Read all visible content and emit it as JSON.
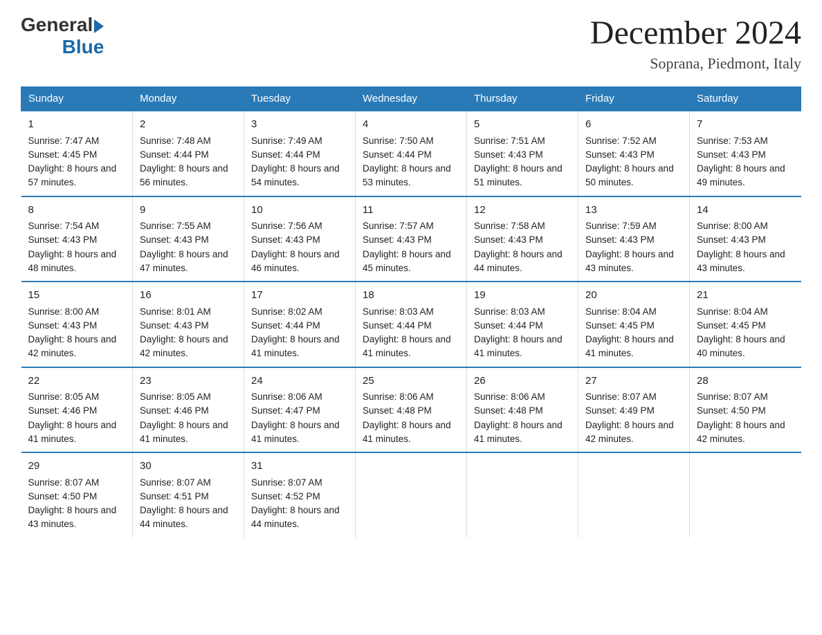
{
  "header": {
    "logo_general": "General",
    "logo_blue": "Blue",
    "main_title": "December 2024",
    "subtitle": "Soprana, Piedmont, Italy"
  },
  "days_of_week": [
    "Sunday",
    "Monday",
    "Tuesday",
    "Wednesday",
    "Thursday",
    "Friday",
    "Saturday"
  ],
  "weeks": [
    [
      {
        "day": "1",
        "sunrise": "7:47 AM",
        "sunset": "4:45 PM",
        "daylight": "8 hours and 57 minutes."
      },
      {
        "day": "2",
        "sunrise": "7:48 AM",
        "sunset": "4:44 PM",
        "daylight": "8 hours and 56 minutes."
      },
      {
        "day": "3",
        "sunrise": "7:49 AM",
        "sunset": "4:44 PM",
        "daylight": "8 hours and 54 minutes."
      },
      {
        "day": "4",
        "sunrise": "7:50 AM",
        "sunset": "4:44 PM",
        "daylight": "8 hours and 53 minutes."
      },
      {
        "day": "5",
        "sunrise": "7:51 AM",
        "sunset": "4:43 PM",
        "daylight": "8 hours and 51 minutes."
      },
      {
        "day": "6",
        "sunrise": "7:52 AM",
        "sunset": "4:43 PM",
        "daylight": "8 hours and 50 minutes."
      },
      {
        "day": "7",
        "sunrise": "7:53 AM",
        "sunset": "4:43 PM",
        "daylight": "8 hours and 49 minutes."
      }
    ],
    [
      {
        "day": "8",
        "sunrise": "7:54 AM",
        "sunset": "4:43 PM",
        "daylight": "8 hours and 48 minutes."
      },
      {
        "day": "9",
        "sunrise": "7:55 AM",
        "sunset": "4:43 PM",
        "daylight": "8 hours and 47 minutes."
      },
      {
        "day": "10",
        "sunrise": "7:56 AM",
        "sunset": "4:43 PM",
        "daylight": "8 hours and 46 minutes."
      },
      {
        "day": "11",
        "sunrise": "7:57 AM",
        "sunset": "4:43 PM",
        "daylight": "8 hours and 45 minutes."
      },
      {
        "day": "12",
        "sunrise": "7:58 AM",
        "sunset": "4:43 PM",
        "daylight": "8 hours and 44 minutes."
      },
      {
        "day": "13",
        "sunrise": "7:59 AM",
        "sunset": "4:43 PM",
        "daylight": "8 hours and 43 minutes."
      },
      {
        "day": "14",
        "sunrise": "8:00 AM",
        "sunset": "4:43 PM",
        "daylight": "8 hours and 43 minutes."
      }
    ],
    [
      {
        "day": "15",
        "sunrise": "8:00 AM",
        "sunset": "4:43 PM",
        "daylight": "8 hours and 42 minutes."
      },
      {
        "day": "16",
        "sunrise": "8:01 AM",
        "sunset": "4:43 PM",
        "daylight": "8 hours and 42 minutes."
      },
      {
        "day": "17",
        "sunrise": "8:02 AM",
        "sunset": "4:44 PM",
        "daylight": "8 hours and 41 minutes."
      },
      {
        "day": "18",
        "sunrise": "8:03 AM",
        "sunset": "4:44 PM",
        "daylight": "8 hours and 41 minutes."
      },
      {
        "day": "19",
        "sunrise": "8:03 AM",
        "sunset": "4:44 PM",
        "daylight": "8 hours and 41 minutes."
      },
      {
        "day": "20",
        "sunrise": "8:04 AM",
        "sunset": "4:45 PM",
        "daylight": "8 hours and 41 minutes."
      },
      {
        "day": "21",
        "sunrise": "8:04 AM",
        "sunset": "4:45 PM",
        "daylight": "8 hours and 40 minutes."
      }
    ],
    [
      {
        "day": "22",
        "sunrise": "8:05 AM",
        "sunset": "4:46 PM",
        "daylight": "8 hours and 41 minutes."
      },
      {
        "day": "23",
        "sunrise": "8:05 AM",
        "sunset": "4:46 PM",
        "daylight": "8 hours and 41 minutes."
      },
      {
        "day": "24",
        "sunrise": "8:06 AM",
        "sunset": "4:47 PM",
        "daylight": "8 hours and 41 minutes."
      },
      {
        "day": "25",
        "sunrise": "8:06 AM",
        "sunset": "4:48 PM",
        "daylight": "8 hours and 41 minutes."
      },
      {
        "day": "26",
        "sunrise": "8:06 AM",
        "sunset": "4:48 PM",
        "daylight": "8 hours and 41 minutes."
      },
      {
        "day": "27",
        "sunrise": "8:07 AM",
        "sunset": "4:49 PM",
        "daylight": "8 hours and 42 minutes."
      },
      {
        "day": "28",
        "sunrise": "8:07 AM",
        "sunset": "4:50 PM",
        "daylight": "8 hours and 42 minutes."
      }
    ],
    [
      {
        "day": "29",
        "sunrise": "8:07 AM",
        "sunset": "4:50 PM",
        "daylight": "8 hours and 43 minutes."
      },
      {
        "day": "30",
        "sunrise": "8:07 AM",
        "sunset": "4:51 PM",
        "daylight": "8 hours and 44 minutes."
      },
      {
        "day": "31",
        "sunrise": "8:07 AM",
        "sunset": "4:52 PM",
        "daylight": "8 hours and 44 minutes."
      },
      {
        "day": "",
        "sunrise": "",
        "sunset": "",
        "daylight": ""
      },
      {
        "day": "",
        "sunrise": "",
        "sunset": "",
        "daylight": ""
      },
      {
        "day": "",
        "sunrise": "",
        "sunset": "",
        "daylight": ""
      },
      {
        "day": "",
        "sunrise": "",
        "sunset": "",
        "daylight": ""
      }
    ]
  ],
  "labels": {
    "sunrise": "Sunrise:",
    "sunset": "Sunset:",
    "daylight": "Daylight:"
  }
}
